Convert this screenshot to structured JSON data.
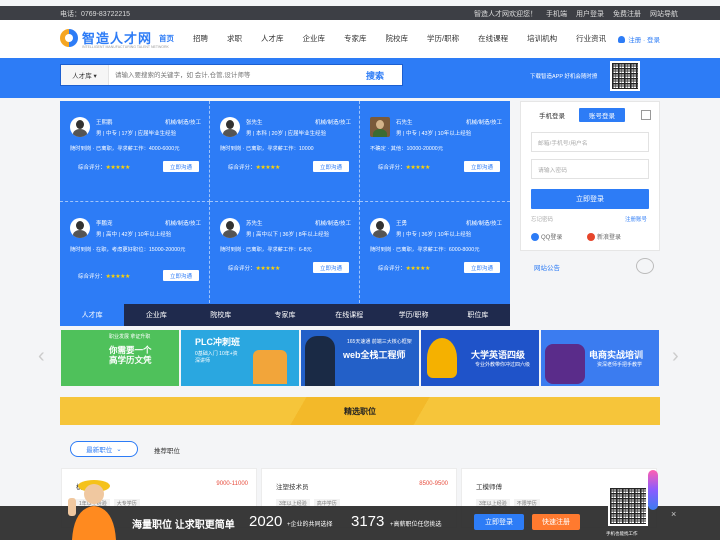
{
  "topbar": {
    "phone": "电话：0769-83722215",
    "welcome": "智造人才网欢迎您！",
    "mobile": "手机端",
    "user_login": "用户登录",
    "free_register": "免费注册",
    "site_nav": "网站导航"
  },
  "logo": {
    "text": "智造人才网",
    "sub": "INTELLIGENT MANUFACTURING TALENT NETWORK"
  },
  "nav": [
    "首页",
    "招聘",
    "求职",
    "人才库",
    "企业库",
    "专家库",
    "院校库",
    "学历/职称",
    "在线课程",
    "培训机构",
    "行业资讯"
  ],
  "header": {
    "login": "注册 · 登录"
  },
  "search": {
    "type": "人才库 ▾",
    "placeholder": "请输入要搜索的关键字，如 会计,仓管,设计师等",
    "button": "搜索",
    "app_text": "下载智造APP 好机会随时撩"
  },
  "talents": [
    {
      "name": "王熙鹏",
      "trade": "机械/制造/技工",
      "info": "男 | 中专 | 17岁 | 应届毕业生经验",
      "status": "随时到岗 · 已离职，寻求薪工作：4000-6000元",
      "score_label": "综合评分：",
      "stars": "★★★★★",
      "chat": "立即沟通"
    },
    {
      "name": "张先生",
      "trade": "机械/制造/技工",
      "info": "男 | 本科 | 20岁 | 应届毕业生经验",
      "status": "随时到岗 · 已离职，寻求薪工作：10000",
      "score_label": "综合评分：",
      "stars": "★★★★★",
      "chat": "立即沟通"
    },
    {
      "name": "石先生",
      "trade": "机械/制造/技工",
      "info": "男 | 中专 | 43岁 | 10年以上经验",
      "status": "不确定 · 其他：10000-20000元",
      "score_label": "综合评分：",
      "stars": "★★★★★",
      "chat": "立即沟通"
    },
    {
      "name": "李鹏宠",
      "trade": "机械/制造/技工",
      "info": "男 | 高中 | 42岁 | 10年以上经验",
      "status": "随时到岗 · 在职，考虑更好职位：15000-20000元",
      "score_label": "综合评分：",
      "stars": "★★★★★",
      "chat": "立即沟通"
    },
    {
      "name": "苏先生",
      "trade": "机械/制造/技工",
      "info": "男 | 高中以下 | 36岁 | 8年以上经验",
      "status": "随时到岗 · 已离职，寻求薪工作：6-8元",
      "score_label": "综合评分：",
      "stars": "★★★★★",
      "chat": "立即沟通"
    },
    {
      "name": "王勇",
      "trade": "机械/制造/技工",
      "info": "男 | 中专 | 36岁 | 10年以上经验",
      "status": "随时到岗 · 已离职，寻求薪工作：6000-8000元",
      "score_label": "综合评分：",
      "stars": "★★★★★",
      "chat": "立即沟通"
    }
  ],
  "grid_tabs": [
    "人才库",
    "企业库",
    "院校库",
    "专家库",
    "在线课程",
    "学历/职称",
    "职位库"
  ],
  "login": {
    "tab_phone": "手机登录",
    "tab_account": "账号登录",
    "username_placeholder": "邮箱/手机号/用户名",
    "password_placeholder": "请输入密码",
    "submit": "立即登录",
    "forgot": "忘记密码",
    "register": "注册账号",
    "qq": "QQ登录",
    "weibo": "新浪登录",
    "notice": "网站公告"
  },
  "banners": [
    {
      "t1": "你需要一个\n高学历文凭",
      "t2": "职业发展 拿证升职",
      "bg": "#4fc15b"
    },
    {
      "t1": "PLC冲刺班",
      "t2": "0基础入门 10年+资深讲师",
      "bg": "#2aa7e0"
    },
    {
      "t1": "web全栈工程师",
      "t2": "165天速通 前端三大核心框架",
      "bg": "#2360c8"
    },
    {
      "t1": "大学英语四级",
      "t2": "专业外教带你冲过四六级",
      "bg": "#1f53c9"
    },
    {
      "t1": "电商实战培训",
      "t2": "资深老师手把手教学",
      "bg": "#3b7cf0"
    }
  ],
  "positions": {
    "title": "精选职位",
    "latest": "最新职位",
    "recommended": "推荐职位",
    "jobs": [
      {
        "title": "模具设计",
        "salary": "9000-11000",
        "tags": [
          "1年以上经验",
          "大专学历"
        ]
      },
      {
        "title": "注塑技术员",
        "salary": "8500-9500",
        "tags": [
          "3年以上经验",
          "高中学历"
        ]
      },
      {
        "title": "工模师傅",
        "salary": "",
        "tags": [
          "3年以上经验",
          "不限学历"
        ]
      }
    ]
  },
  "promo": {
    "slogan": "海量职位 让求职更简单",
    "n1": "2020",
    "l1": "+企业的共同选择",
    "n2": "3173",
    "l2": "+高薪职位任您挑选",
    "login": "立即登录",
    "register": "快速注册",
    "qr_caption": "手机也能找工作",
    "close": "×"
  },
  "colors": {
    "brand": "#2d7cf6",
    "dark_nav": "#1f2a4d",
    "accent": "#ff7a2f",
    "salary": "#e74c3c",
    "star": "#ffd400"
  }
}
